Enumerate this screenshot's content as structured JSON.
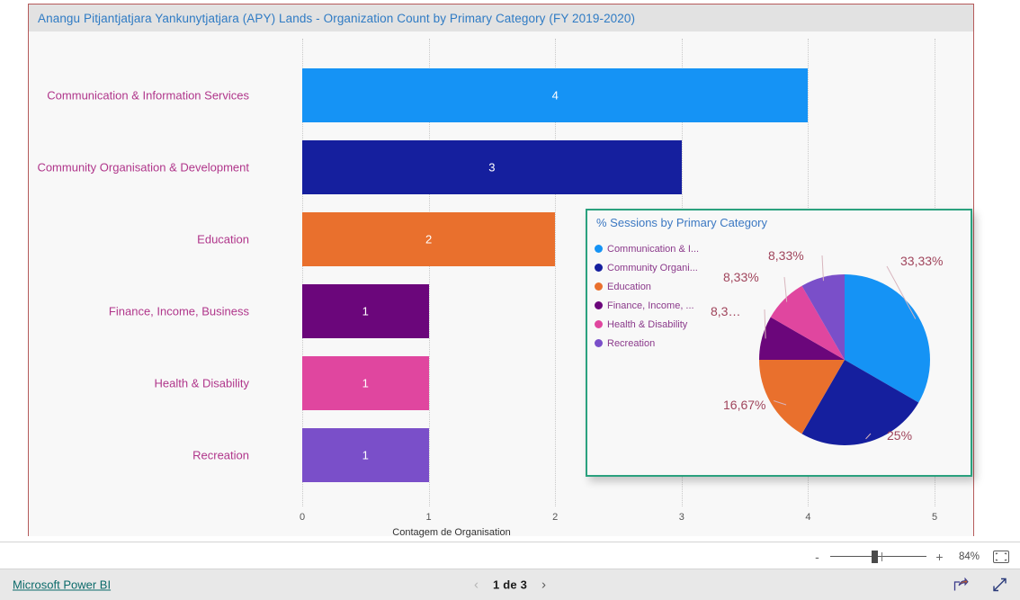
{
  "report": {
    "title": "Anangu Pitjantjatjara Yankunytjatjara (APY) Lands - Organization Count by Primary Category (FY 2019-2020)",
    "border_color": "#b55a5a",
    "title_color": "#2f7bc4",
    "titlebar_bg": "#e2e2e2"
  },
  "chart_data": [
    {
      "type": "bar",
      "orientation": "horizontal",
      "title": "Anangu Pitjantjatjara Yankunytjatjara (APY) Lands - Organization Count by Primary Category (FY 2019-2020)",
      "xlabel": "Contagem de Organisation",
      "ylabel": "",
      "xlim": [
        0,
        5
      ],
      "xticks": [
        "0",
        "1",
        "2",
        "3",
        "4",
        "5"
      ],
      "grid": true,
      "categories": [
        "Communication & Information Services",
        "Community Organisation & Development",
        "Education",
        "Finance, Income, Business",
        "Health & Disability",
        "Recreation"
      ],
      "values": [
        4,
        3,
        2,
        1,
        1,
        1
      ],
      "value_labels": [
        "4",
        "3",
        "2",
        "1",
        "1",
        "1"
      ],
      "colors": [
        "#1593f5",
        "#151f9e",
        "#e9702d",
        "#6b067b",
        "#e0469f",
        "#7a4fc9"
      ],
      "label_color": "#b0368b"
    },
    {
      "type": "pie",
      "title": "% Sessions by Primary Category",
      "title_color": "#3b78c2",
      "panel_border_color": "#2aa17e",
      "legend_position": "left",
      "legend": [
        "Communication & I...",
        "Community Organi...",
        "Education",
        "Finance, Income, ...",
        "Health & Disability",
        "Recreation"
      ],
      "categories": [
        "Communication & Information Services",
        "Community Organisation & Development",
        "Education",
        "Finance, Income, Business",
        "Health & Disability",
        "Recreation"
      ],
      "values": [
        33.33,
        25,
        16.67,
        8.33,
        8.33,
        8.33
      ],
      "data_labels": [
        "33,33%",
        "25%",
        "16,67%",
        "8,3…",
        "8,33%",
        "8,33%"
      ],
      "colors": [
        "#1593f5",
        "#151f9e",
        "#e9702d",
        "#6b067b",
        "#e0469f",
        "#7a4fc9"
      ],
      "label_color": "#a0455c"
    }
  ],
  "toolbar": {
    "zoom_out_label": "-",
    "zoom_in_label": "+",
    "zoom_percent": "84%",
    "fit_to_page_icon": "fit-page-icon"
  },
  "status": {
    "brand_link": "Microsoft Power BI",
    "prev_arrow": "‹",
    "next_arrow": "›",
    "page_label": "1 de 3",
    "share_icon": "share-icon",
    "fullscreen_icon": "fullscreen-icon"
  }
}
